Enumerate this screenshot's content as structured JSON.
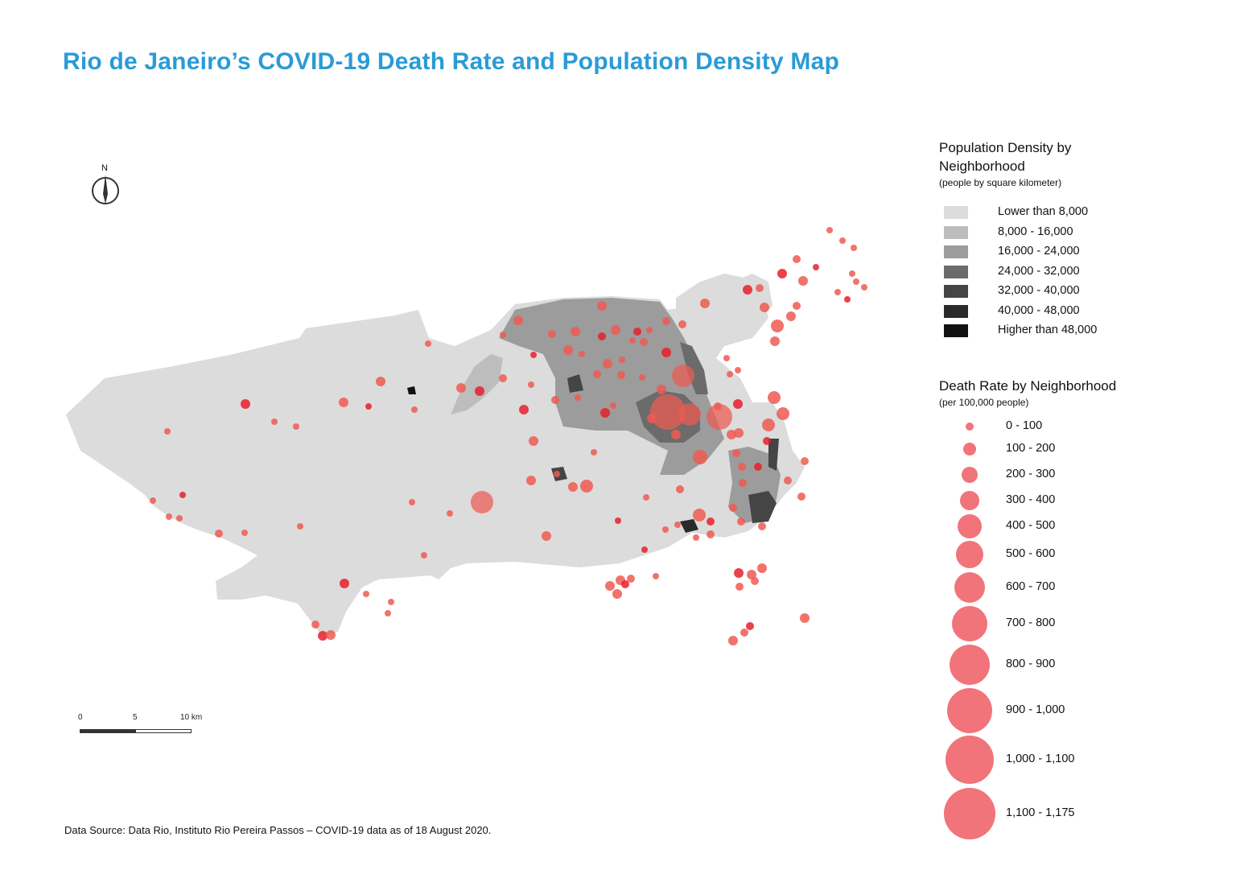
{
  "title": "Rio de Janeiro’s COVID-19 Death Rate and Population Density Map",
  "north_label": "N",
  "scale_bar": {
    "labels": [
      "0",
      "5",
      "10 km"
    ]
  },
  "source": "Data Source: Data Rio, Instituto Rio Pereira Passos – COVID-19 data as of 18 August 2020.",
  "colors": {
    "title": "#2a9bd6",
    "marker": "#ee5a52",
    "marker_alt": "#e8202a",
    "legend_marker": "#f0747a"
  },
  "legend": {
    "density": {
      "title": "Population Density by Neighborhood",
      "subtitle": "(people by square kilometer)",
      "items": [
        {
          "label": "Lower than 8,000",
          "color": "#dcdcdc"
        },
        {
          "label": "8,000 - 16,000",
          "color": "#bdbdbd"
        },
        {
          "label": "16,000 - 24,000",
          "color": "#9c9c9c"
        },
        {
          "label": "24,000 - 32,000",
          "color": "#6b6b6b"
        },
        {
          "label": "32,000 - 40,000",
          "color": "#454545"
        },
        {
          "label": "40,000 - 48,000",
          "color": "#2a2a2a"
        },
        {
          "label": "Higher than 48,000",
          "color": "#111111"
        }
      ]
    },
    "death_rate": {
      "title": "Death Rate by Neighborhood",
      "subtitle": "(per 100,000 people)",
      "items": [
        {
          "label": "0 - 100"
        },
        {
          "label": "100 - 200"
        },
        {
          "label": "200 - 300"
        },
        {
          "label": "300 - 400"
        },
        {
          "label": "400 - 500"
        },
        {
          "label": "500 - 600"
        },
        {
          "label": "600 - 700"
        },
        {
          "label": "700 - 800"
        },
        {
          "label": "800 - 900"
        },
        {
          "label": "900 - 1,000"
        },
        {
          "label": "1,000 - 1,100"
        },
        {
          "label": "1,100 - 1,175"
        }
      ]
    }
  }
}
